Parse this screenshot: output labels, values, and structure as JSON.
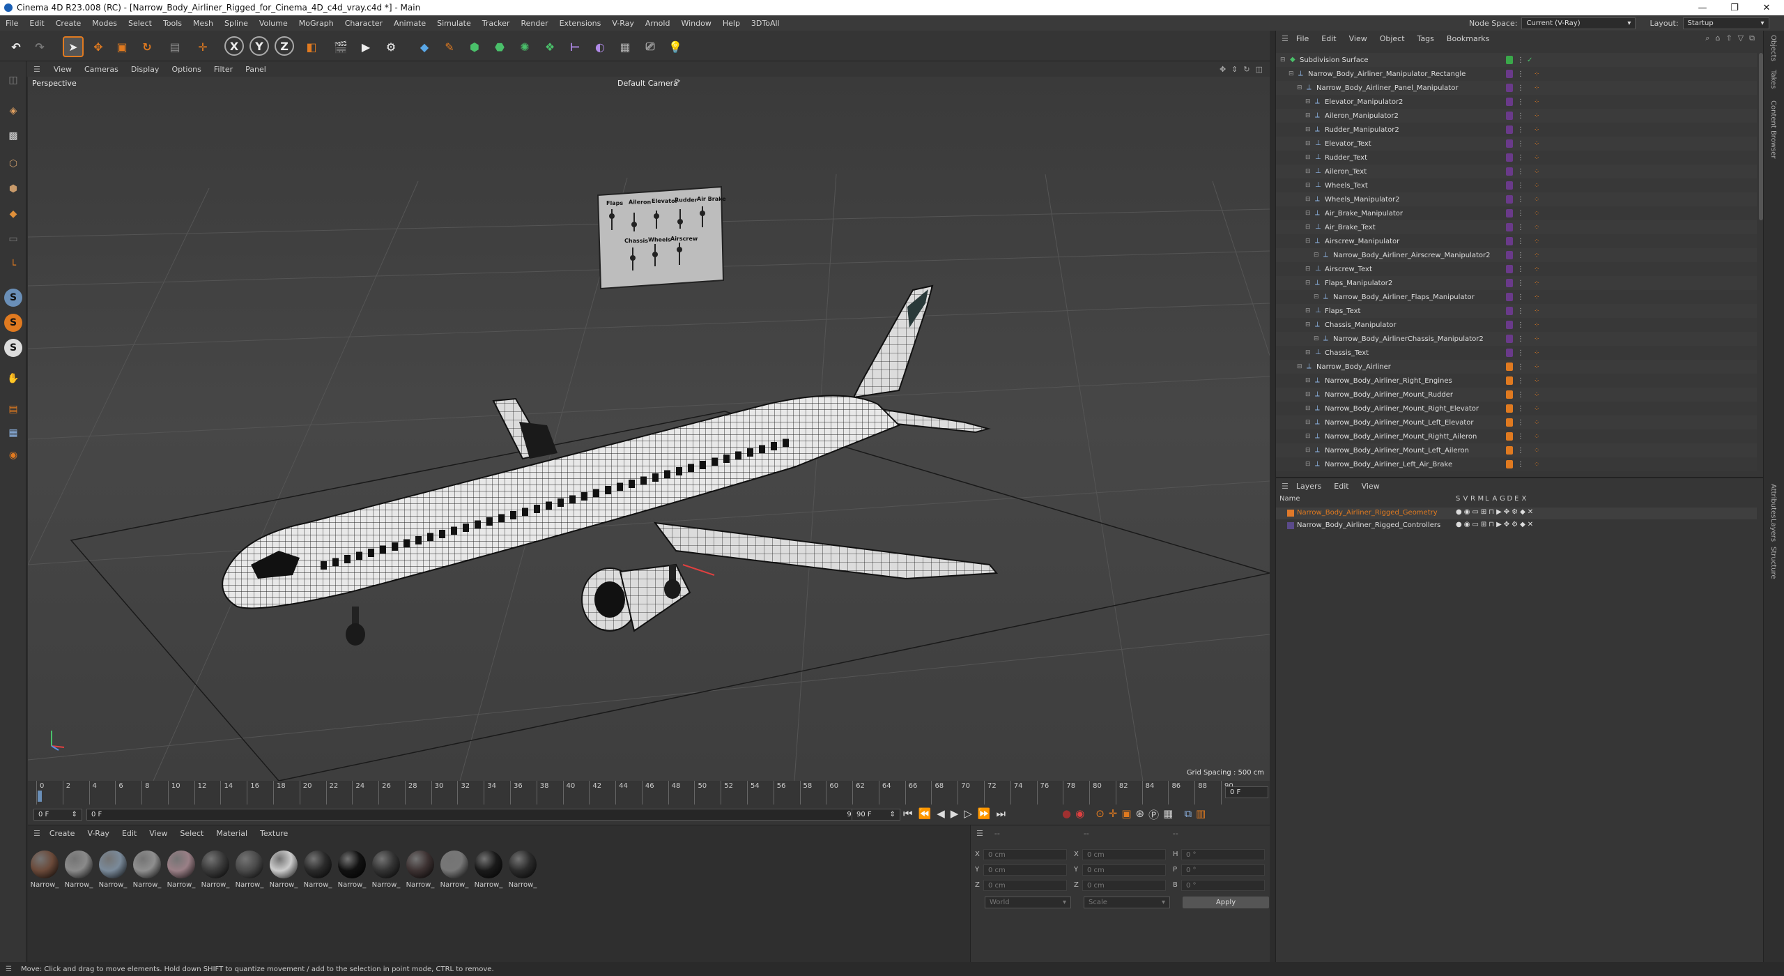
{
  "window": {
    "title": "Cinema 4D R23.008 (RC) - [Narrow_Body_Airliner_Rigged_for_Cinema_4D_c4d_vray.c4d *] - Main",
    "controls": [
      "—",
      "❐",
      "✕"
    ]
  },
  "menubar": {
    "items": [
      "File",
      "Edit",
      "Create",
      "Modes",
      "Select",
      "Tools",
      "Mesh",
      "Spline",
      "Volume",
      "MoGraph",
      "Character",
      "Animate",
      "Simulate",
      "Tracker",
      "Render",
      "Extensions",
      "V-Ray",
      "Arnold",
      "Window",
      "Help",
      "3DToAll"
    ],
    "node_space_label": "Node Space:",
    "node_space_value": "Current (V-Ray)",
    "layout_label": "Layout:",
    "layout_value": "Startup"
  },
  "toolbar": {
    "axis_x": "X",
    "axis_y": "Y",
    "axis_z": "Z"
  },
  "left_tools": {
    "s1": "S",
    "s2": "S",
    "s3": "S"
  },
  "viewport": {
    "menu": [
      "View",
      "Cameras",
      "Display",
      "Options",
      "Filter",
      "Panel"
    ],
    "label": "Perspective",
    "camera": "Default Camera",
    "grid_spacing": "Grid Spacing : 500 cm",
    "panel_top_labels": [
      "Flaps",
      "Aileron",
      "Elevator",
      "Rudder",
      "Air Brake"
    ],
    "panel_bottom_labels": [
      "Chassis",
      "Wheels",
      "Airscrew"
    ]
  },
  "timeline": {
    "ticks": [
      "0",
      "2",
      "4",
      "6",
      "8",
      "10",
      "12",
      "14",
      "16",
      "18",
      "20",
      "22",
      "24",
      "26",
      "28",
      "30",
      "32",
      "34",
      "36",
      "38",
      "40",
      "42",
      "44",
      "46",
      "48",
      "50",
      "52",
      "54",
      "56",
      "58",
      "60",
      "62",
      "64",
      "66",
      "68",
      "70",
      "72",
      "74",
      "76",
      "78",
      "80",
      "82",
      "84",
      "86",
      "88",
      "90"
    ],
    "current_frame_display": "0 F",
    "start_field": "0 F",
    "current_field": "0 F",
    "end_field": "90 F",
    "end_field_2": "90 F"
  },
  "material_panel": {
    "menu": [
      "Create",
      "V-Ray",
      "Edit",
      "View",
      "Select",
      "Material",
      "Texture"
    ],
    "materials": [
      {
        "label": "Narrow_",
        "color": "#6b4a3a"
      },
      {
        "label": "Narrow_",
        "color": "#8a8a8a"
      },
      {
        "label": "Narrow_",
        "color": "#7a8a9a"
      },
      {
        "label": "Narrow_",
        "color": "#8f8f8f"
      },
      {
        "label": "Narrow_",
        "color": "#9a7f86"
      },
      {
        "label": "Narrow_",
        "color": "#3a3a3a"
      },
      {
        "label": "Narrow_",
        "color": "#4a4a4a"
      },
      {
        "label": "Narrow_",
        "color": "#cccccc"
      },
      {
        "label": "Narrow_",
        "color": "#2a2a2a"
      },
      {
        "label": "Narrow_",
        "color": "#111111"
      },
      {
        "label": "Narrow_",
        "color": "#333333"
      },
      {
        "label": "Narrow_",
        "color": "#3d3232"
      },
      {
        "label": "Narrow_",
        "color": "#777777"
      },
      {
        "label": "Narrow_",
        "color": "#1a1a1a"
      },
      {
        "label": "Narrow_",
        "color": "#2b2b2b"
      }
    ]
  },
  "coordinates": {
    "header_left": "--",
    "header_mid": "--",
    "header_right": "--",
    "rows": [
      {
        "l1": "X",
        "v1": "0 cm",
        "l2": "X",
        "v2": "0 cm",
        "l3": "H",
        "v3": "0 °"
      },
      {
        "l1": "Y",
        "v1": "0 cm",
        "l2": "Y",
        "v2": "0 cm",
        "l3": "P",
        "v3": "0 °"
      },
      {
        "l1": "Z",
        "v1": "0 cm",
        "l2": "Z",
        "v2": "0 cm",
        "l3": "B",
        "v3": "0 °"
      }
    ],
    "mode": "World",
    "size_mode": "Scale",
    "apply": "Apply"
  },
  "object_panel": {
    "menu": [
      "File",
      "Edit",
      "View",
      "Object",
      "Tags",
      "Bookmarks"
    ],
    "rows": [
      {
        "name": "Subdivision Surface",
        "depth": 0,
        "icon": "subdivision-icon",
        "tag": "green"
      },
      {
        "name": "Narrow_Body_Airliner_Manipulator_Rectangle",
        "depth": 1,
        "icon": "null-icon",
        "tag": "purple"
      },
      {
        "name": "Narrow_Body_Airliner_Panel_Manipulator",
        "depth": 2,
        "icon": "null-icon",
        "tag": "purple"
      },
      {
        "name": "Elevator_Manipulator2",
        "depth": 3,
        "icon": "null-icon",
        "tag": "purple"
      },
      {
        "name": "Aileron_Manipulator2",
        "depth": 3,
        "icon": "null-icon",
        "tag": "purple"
      },
      {
        "name": "Rudder_Manipulator2",
        "depth": 3,
        "icon": "null-icon",
        "tag": "purple"
      },
      {
        "name": "Elevator_Text",
        "depth": 3,
        "icon": "text-icon",
        "tag": "purple"
      },
      {
        "name": "Rudder_Text",
        "depth": 3,
        "icon": "text-icon",
        "tag": "purple"
      },
      {
        "name": "Aileron_Text",
        "depth": 3,
        "icon": "text-icon",
        "tag": "purple"
      },
      {
        "name": "Wheels_Text",
        "depth": 3,
        "icon": "text-icon",
        "tag": "purple"
      },
      {
        "name": "Wheels_Manipulator2",
        "depth": 3,
        "icon": "null-icon",
        "tag": "purple"
      },
      {
        "name": "Air_Brake_Manipulator",
        "depth": 3,
        "icon": "null-icon",
        "tag": "purple"
      },
      {
        "name": "Air_Brake_Text",
        "depth": 3,
        "icon": "text-icon",
        "tag": "purple"
      },
      {
        "name": "Airscrew_Manipulator",
        "depth": 3,
        "icon": "null-icon",
        "tag": "purple"
      },
      {
        "name": "Narrow_Body_Airliner_Airscrew_Manipulator2",
        "depth": 4,
        "icon": "null-icon",
        "tag": "purple"
      },
      {
        "name": "Airscrew_Text",
        "depth": 3,
        "icon": "text-icon",
        "tag": "purple"
      },
      {
        "name": "Flaps_Manipulator2",
        "depth": 3,
        "icon": "null-icon",
        "tag": "purple"
      },
      {
        "name": "Narrow_Body_Airliner_Flaps_Manipulator",
        "depth": 4,
        "icon": "null-icon",
        "tag": "purple"
      },
      {
        "name": "Flaps_Text",
        "depth": 3,
        "icon": "text-icon",
        "tag": "purple"
      },
      {
        "name": "Chassis_Manipulator",
        "depth": 3,
        "icon": "null-icon",
        "tag": "purple"
      },
      {
        "name": "Narrow_Body_AirlinerChassis_Manipulator2",
        "depth": 4,
        "icon": "null-icon",
        "tag": "purple"
      },
      {
        "name": "Chassis_Text",
        "depth": 3,
        "icon": "text-icon",
        "tag": "purple"
      },
      {
        "name": "Narrow_Body_Airliner",
        "depth": 2,
        "icon": "null-icon",
        "tag": "orange"
      },
      {
        "name": "Narrow_Body_Airliner_Right_Engines",
        "depth": 3,
        "icon": "null-icon",
        "tag": "orange"
      },
      {
        "name": "Narrow_Body_Airliner_Mount_Rudder",
        "depth": 3,
        "icon": "null-icon",
        "tag": "orange"
      },
      {
        "name": "Narrow_Body_Airliner_Mount_Right_Elevator",
        "depth": 3,
        "icon": "null-icon",
        "tag": "orange"
      },
      {
        "name": "Narrow_Body_Airliner_Mount_Left_Elevator",
        "depth": 3,
        "icon": "null-icon",
        "tag": "orange"
      },
      {
        "name": "Narrow_Body_Airliner_Mount_Rightt_Aileron",
        "depth": 3,
        "icon": "null-icon",
        "tag": "orange"
      },
      {
        "name": "Narrow_Body_Airliner_Mount_Left_Aileron",
        "depth": 3,
        "icon": "null-icon",
        "tag": "orange"
      },
      {
        "name": "Narrow_Body_Airliner_Left_Air_Brake",
        "depth": 3,
        "icon": "null-icon",
        "tag": "orange"
      }
    ]
  },
  "layer_panel": {
    "menu": [
      "Layers",
      "Edit",
      "View"
    ],
    "col_name": "Name",
    "col_flags": [
      "S",
      "V",
      "R",
      "M",
      "L",
      "A",
      "G",
      "D",
      "E",
      "X"
    ],
    "layers": [
      {
        "name": "Narrow_Body_Airliner_Rigged_Geometry",
        "color": "#e0792a",
        "selected": true
      },
      {
        "name": "Narrow_Body_Airliner_Rigged_Controllers",
        "color": "#5a4a8a",
        "selected": false
      }
    ]
  },
  "side_tabs": [
    "Objects",
    "Takes",
    "Content Browser",
    "Attributes",
    "Layers",
    "Structure"
  ],
  "status": {
    "text": "Move: Click and drag to move elements. Hold down SHIFT to quantize movement / add to the selection in point mode, CTRL to remove."
  },
  "colors": {
    "accent_orange": "#e07a20",
    "tag_purple": "#6a3a8a",
    "tag_green": "#3aa84a"
  }
}
